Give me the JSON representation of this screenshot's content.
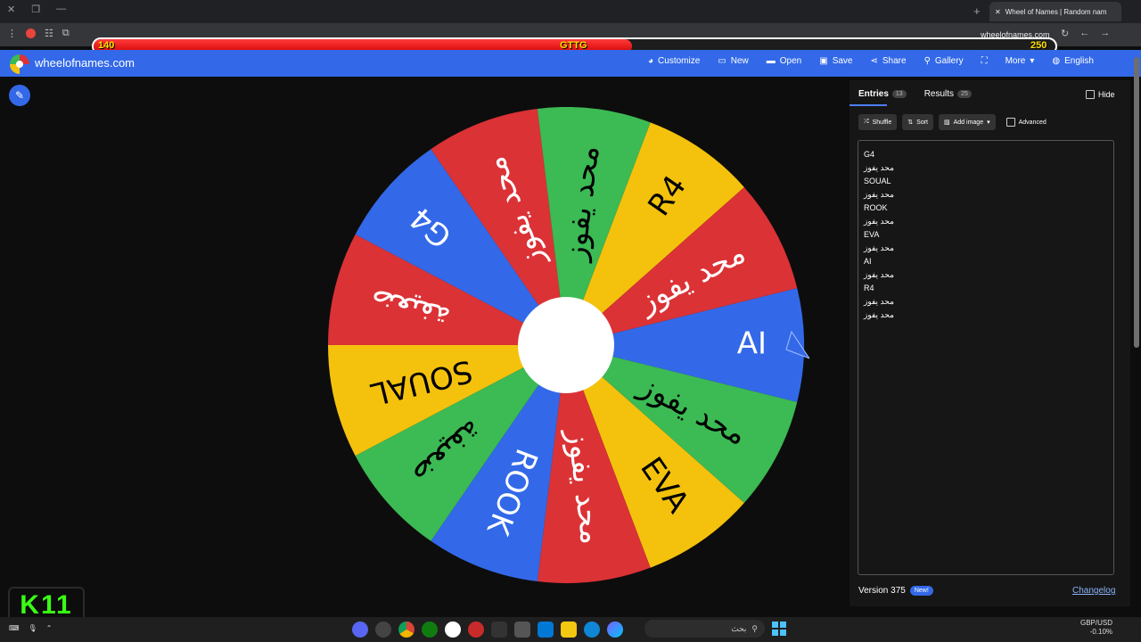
{
  "browser": {
    "tab_title": "Wheel of Names | Random nam",
    "url": "wheelofnames.com"
  },
  "overlay": {
    "left_score": "140",
    "center_label": "GTTG",
    "right_score": "250",
    "progress": 0.56,
    "badge": "11"
  },
  "site": {
    "name": "wheelofnames.com",
    "menu": [
      "Customize",
      "New",
      "Open",
      "Save",
      "Share",
      "Gallery",
      "More",
      "English"
    ]
  },
  "panel": {
    "tabs": [
      {
        "label": "Entries",
        "count": "13"
      },
      {
        "label": "Results",
        "count": "25"
      }
    ],
    "hide_label": "Hide",
    "toolbar": {
      "shuffle": "Shuffle",
      "sort": "Sort",
      "add_image": "Add image",
      "advanced": "Advanced"
    },
    "entries": [
      "G4",
      "محد يفوز",
      "SOUAL",
      "محد يفوز",
      "ROOK",
      "محد يفوز",
      "EVA",
      "محد يفوز",
      "AI",
      "محد يفوز",
      "R4",
      "محد يفوز",
      "محد يفوز"
    ],
    "version": "Version 375",
    "new_badge": "New!",
    "changelog": "Changelog"
  },
  "wheel": {
    "segments": [
      {
        "label": "AI",
        "color": "#3369e8"
      },
      {
        "label": "محد يفوز",
        "color": "#3cba54"
      },
      {
        "label": "EVA",
        "color": "#f4c20d"
      },
      {
        "label": "محد يفوز",
        "color": "#db3236"
      },
      {
        "label": "ROOK",
        "color": "#3369e8"
      },
      {
        "label": "ضعيفة",
        "color": "#3cba54"
      },
      {
        "label": "SOUAL",
        "color": "#f4c20d"
      },
      {
        "label": "ضعيفة",
        "color": "#db3236"
      },
      {
        "label": "G4",
        "color": "#3369e8"
      },
      {
        "label": "محد يفوز",
        "color": "#db3236"
      },
      {
        "label": "محد يفوز",
        "color": "#3cba54"
      },
      {
        "label": "R4",
        "color": "#f4c20d"
      },
      {
        "label": "محد يفوز",
        "color": "#db3236"
      }
    ]
  },
  "taskbar": {
    "search_text": "بحث",
    "tray_currency": "GBP/USD",
    "tray_value": "-0.10%"
  },
  "colors": {
    "accent": "#3369e8",
    "panel": "#161616"
  }
}
